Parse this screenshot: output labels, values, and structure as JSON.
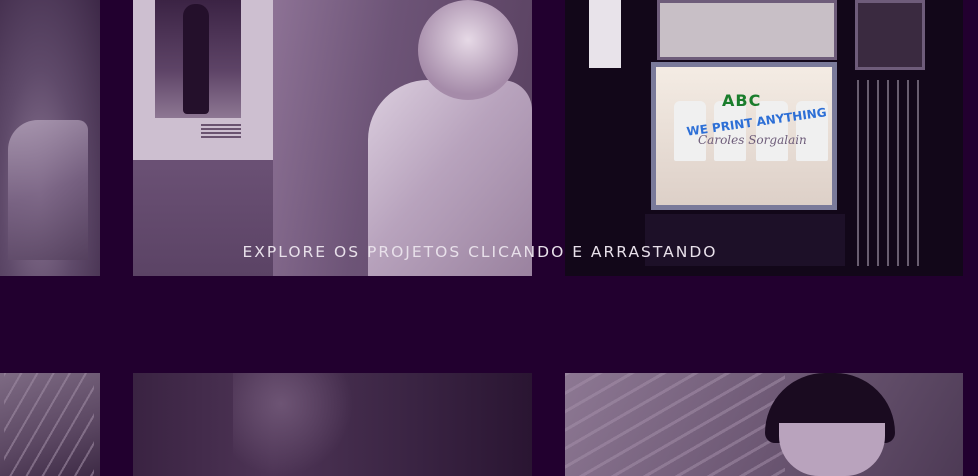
{
  "gallery": {
    "hint": "EXPLORE OS PROJETOS CLICANDO E ARRASTANDO",
    "window_text": {
      "line1": "ABC",
      "line2": "WE PRINT ANYTHING",
      "line3": "Caroles Sorgalain"
    }
  },
  "colors": {
    "background": "#22002f",
    "hint_text": "#e8e0ea"
  }
}
